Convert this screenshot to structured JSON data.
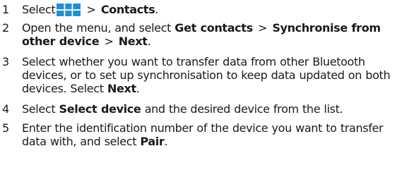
{
  "steps": [
    {
      "number": "1",
      "text_before": "Select",
      "icon": "menu-key-icon",
      "separator": ">",
      "ui_1": "Contacts",
      "text_after": "."
    },
    {
      "number": "2",
      "text_before": "Open the menu, and select",
      "ui_1": "Get contacts",
      "separator": ">",
      "ui_2": "Synchronise from other device",
      "separator_2": ">",
      "ui_3": "Next",
      "text_after": "."
    },
    {
      "number": "3",
      "text_before": "Select whether you want to transfer data from other Bluetooth devices, or to set up synchronisation to keep data updated on both devices. Select",
      "ui_1": "Next",
      "text_after": "."
    },
    {
      "number": "4",
      "text_before": "Select",
      "ui_1": "Select device",
      "text_after": "and the desired device from the list."
    },
    {
      "number": "5",
      "text_before": "Enter the identification number of the device you want to transfer data with, and select",
      "ui_1": "Pair",
      "text_after": "."
    }
  ],
  "colors": {
    "text": "#1a1a1a",
    "icon": "#1e8fd6"
  }
}
